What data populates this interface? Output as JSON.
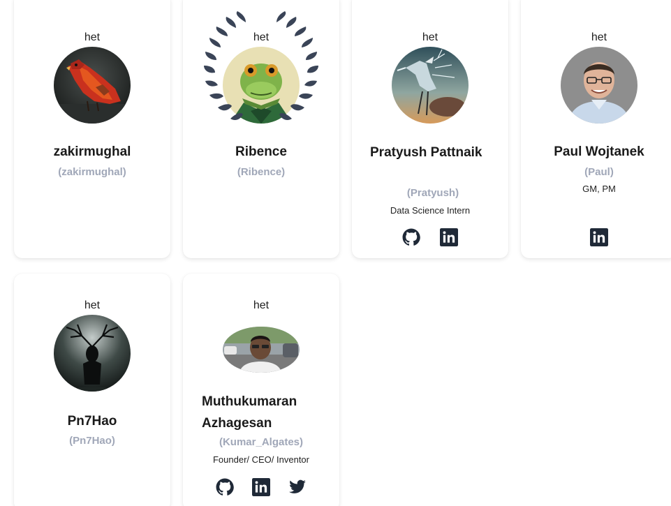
{
  "members": [
    {
      "label": "het",
      "name": "zakirmughal",
      "username": "(zakirmughal)",
      "role": ""
    },
    {
      "label": "het",
      "name": "Ribence",
      "username": "(Ribence)",
      "role": ""
    },
    {
      "label": "het",
      "name": "Pratyush Pattnaik",
      "username": "(Pratyush)",
      "role": "Data Science Intern",
      "socials": [
        "github-icon",
        "linkedin-icon"
      ]
    },
    {
      "label": "het",
      "name": "Paul Wojtanek",
      "username": "(Paul)",
      "role": "GM, PM",
      "socials": [
        "linkedin-icon"
      ]
    },
    {
      "label": "het",
      "name": "Pn7Hao",
      "username": "(Pn7Hao)",
      "role": ""
    },
    {
      "label": "het",
      "name": "Muthukumaran Azhagesan",
      "username": "(Kumar_Algates)",
      "role": "Founder/ CEO/ Inventor",
      "socials": [
        "github-icon",
        "linkedin-icon",
        "twitter-icon"
      ]
    }
  ],
  "colors": {
    "username": "#a0a7b8",
    "icon": "#1f2937",
    "card_bg": "#ffffff"
  }
}
